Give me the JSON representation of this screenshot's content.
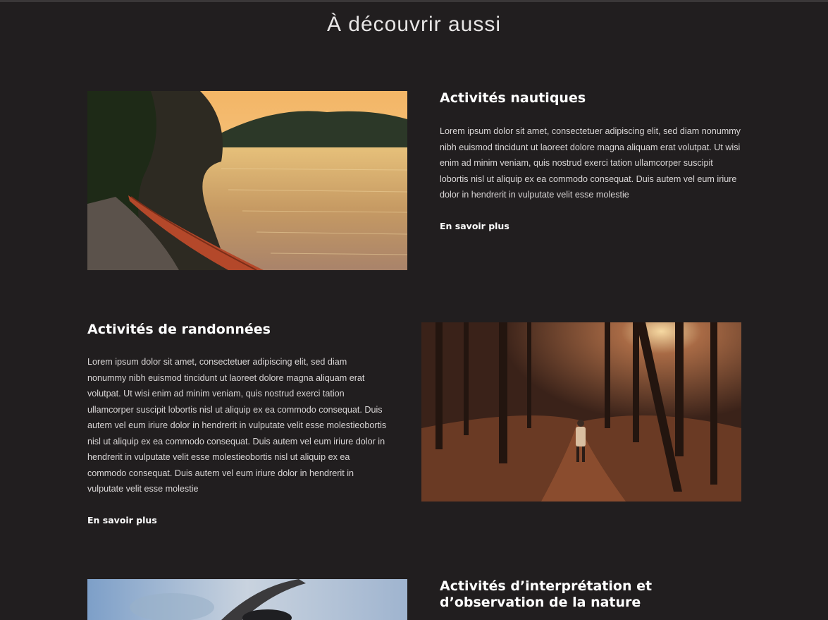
{
  "section_title": "À découvrir  aussi",
  "activities": [
    {
      "title": "Activités nautiques",
      "description": "Lorem ipsum dolor sit amet, consectetuer adipiscing elit, sed diam nonummy nibh euismod tincidunt ut laoreet dolore magna aliquam erat volutpat. Ut wisi enim ad minim veniam, quis nostrud exerci tation ullamcorper suscipit lobortis nisl ut aliquip ex ea commodo consequat. Duis autem vel eum iriure dolor in hendrerit in vulputate velit esse molestie",
      "link_label": "En savoir plus"
    },
    {
      "title": "Activités de randonnées",
      "description": "Lorem ipsum dolor sit amet, consectetuer adipiscing elit, sed diam nonummy nibh euismod tincidunt ut laoreet dolore magna aliquam erat volutpat. Ut wisi enim ad minim veniam, quis nostrud exerci tation ullamcorper suscipit lobortis nisl ut aliquip ex ea commodo consequat. Duis autem vel eum iriure dolor in hendrerit in vulputate velit esse molestieobortis nisl ut aliquip ex ea commodo consequat. Duis autem vel eum iriure dolor in hendrerit in vulputate velit esse molestieobortis nisl ut aliquip ex ea commodo consequat. Duis autem vel eum iriure dolor in hendrerit in vulputate velit esse molestie",
      "link_label": "En savoir plus"
    },
    {
      "title": "Activités d’interprétation et d’observation de la nature"
    }
  ],
  "colors": {
    "background": "#211e1f",
    "text": "#ffffff",
    "body_text": "#d9d6d6"
  }
}
